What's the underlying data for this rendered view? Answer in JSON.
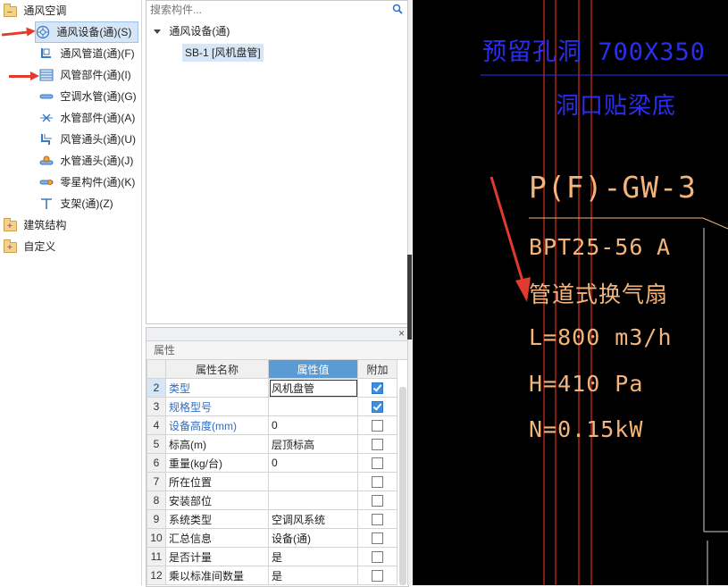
{
  "left_tree": {
    "root": {
      "label": "通风空调"
    },
    "items": [
      {
        "label": "通风设备(通)(S)",
        "icon": "fan-device-icon",
        "selected": true
      },
      {
        "label": "通风管道(通)(F)",
        "icon": "duct-icon"
      },
      {
        "label": "风管部件(通)(I)",
        "icon": "duct-component-icon"
      },
      {
        "label": "空调水管(通)(G)",
        "icon": "water-pipe-icon"
      },
      {
        "label": "水管部件(通)(A)",
        "icon": "pipe-component-icon"
      },
      {
        "label": "风管通头(通)(U)",
        "icon": "duct-fitting-icon"
      },
      {
        "label": "水管通头(通)(J)",
        "icon": "pipe-fitting-icon"
      },
      {
        "label": "零星构件(通)(K)",
        "icon": "misc-component-icon"
      },
      {
        "label": "支架(通)(Z)",
        "icon": "bracket-icon"
      }
    ],
    "others": [
      {
        "label": "建筑结构"
      },
      {
        "label": "自定义"
      }
    ]
  },
  "search": {
    "placeholder": "搜索构件..."
  },
  "component_tree": {
    "group": "通风设备(通)",
    "item": "SB-1 [风机盘管]"
  },
  "properties": {
    "title": "属性",
    "headers": {
      "name": "属性名称",
      "value": "属性值",
      "extra": "附加"
    },
    "rows": [
      {
        "num": "2",
        "name": "类型",
        "value": "风机盘管",
        "checked": true,
        "blue": true
      },
      {
        "num": "3",
        "name": "规格型号",
        "value": "",
        "checked": true,
        "blue": true
      },
      {
        "num": "4",
        "name": "设备高度(mm)",
        "value": "0",
        "checked": false,
        "blue": true
      },
      {
        "num": "5",
        "name": "标高(m)",
        "value": "层顶标高",
        "checked": false,
        "blue": false
      },
      {
        "num": "6",
        "name": "重量(kg/台)",
        "value": "0",
        "checked": false,
        "blue": false
      },
      {
        "num": "7",
        "name": "所在位置",
        "value": "",
        "checked": false,
        "blue": false
      },
      {
        "num": "8",
        "name": "安装部位",
        "value": "",
        "checked": false,
        "blue": false
      },
      {
        "num": "9",
        "name": "系统类型",
        "value": "空调风系统",
        "checked": false,
        "blue": false
      },
      {
        "num": "10",
        "name": "汇总信息",
        "value": "设备(通)",
        "checked": false,
        "blue": false
      },
      {
        "num": "11",
        "name": "是否计量",
        "value": "是",
        "checked": false,
        "blue": false
      },
      {
        "num": "12",
        "name": "乘以标准间数量",
        "value": "是",
        "checked": false,
        "blue": false
      }
    ]
  },
  "cad": {
    "blue_text_1": "预留孔洞 700X350",
    "blue_text_2": "洞口贴梁底",
    "tag": "P(F)-GW-3",
    "model": "BPT25-56",
    "model_suffix": "A",
    "name": "管道式换气扇",
    "airflow": "L=800 m3/h",
    "pressure": "H=410 Pa",
    "power": "N=0.15kW"
  },
  "colors": {
    "cad_background": "#000000",
    "cad_blue": "#2a2ef0",
    "cad_orange": "#f4b47a",
    "cad_red_line": "#d83020",
    "annotation_arrow": "#e23b2e",
    "header_blue": "#5b9bd5"
  }
}
